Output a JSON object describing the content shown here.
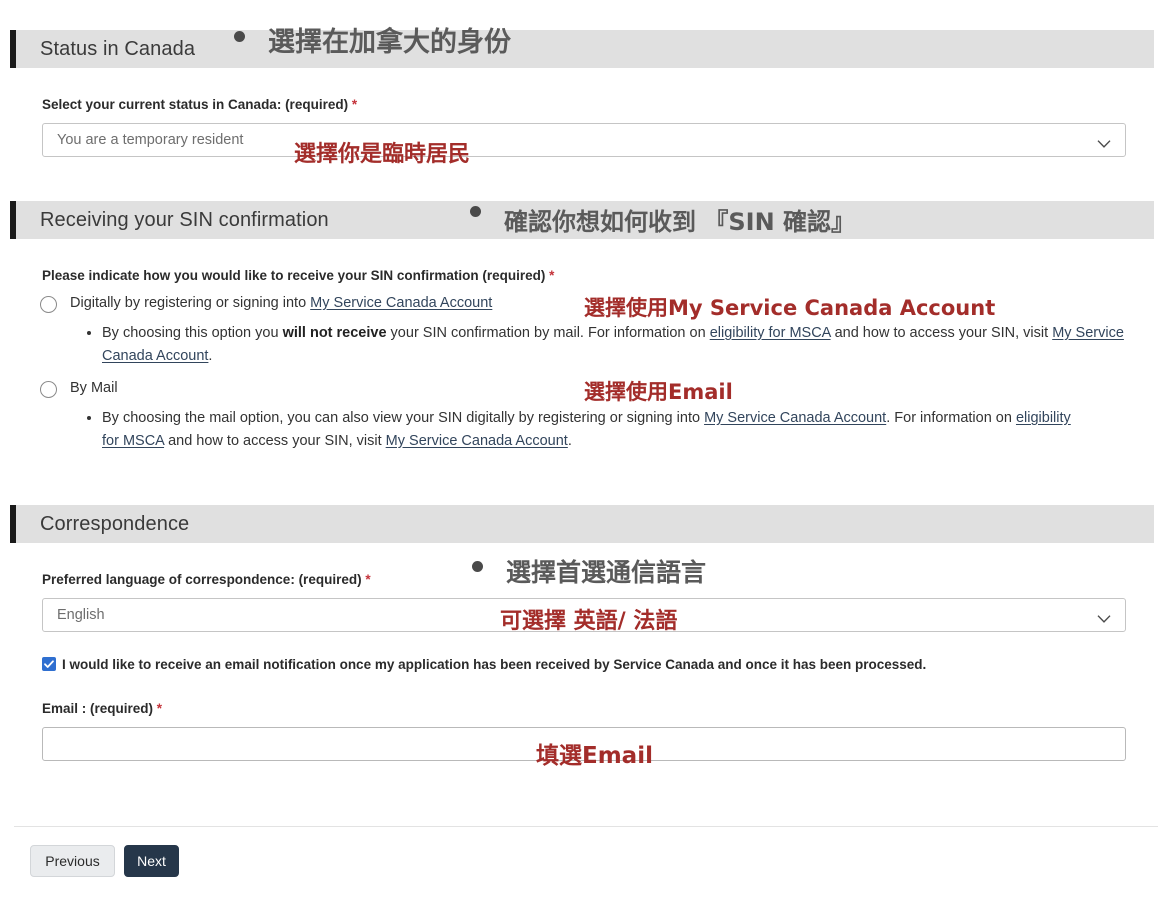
{
  "sections": {
    "status": {
      "header": "Status in Canada",
      "annotation": "選擇在加拿大的身份",
      "field_label": "Select your current status in Canada: (required)",
      "required_mark": "*",
      "select_value": "You are a temporary resident",
      "select_annotation": "選擇你是臨時居民",
      "chevron_icon": "chevron-down-icon"
    },
    "receiving": {
      "header": "Receiving your SIN confirmation",
      "annotation": "確認你想如何收到 『SIN 確認』",
      "field_label": "Please indicate how you would like to receive your SIN confirmation (required)",
      "required_mark": "*",
      "option_digital": {
        "label_pre": "Digitally by registering or signing into ",
        "label_link": "My Service Canada Account",
        "annotation": "選擇使用My Service Canada Account",
        "bullet_p1": "By choosing this option you ",
        "bullet_strong": "will not receive",
        "bullet_p2": " your SIN confirmation by mail. For information on ",
        "bullet_link1": "eligibility for MSCA",
        "bullet_p3": " and how to access your SIN, visit ",
        "bullet_link2": "My Service Canada Account",
        "bullet_p4": "."
      },
      "option_mail": {
        "label": "By Mail",
        "annotation": "選擇使用Email",
        "bullet_p1": "By choosing the mail option, you can also view your SIN digitally by registering or signing into ",
        "bullet_link1": "My Service Canada Account",
        "bullet_p2": ". For information on ",
        "bullet_link2": "eligibility for MSCA",
        "bullet_p3": " and how to access your SIN, visit ",
        "bullet_link3": "My Service Canada Account",
        "bullet_p4": "."
      }
    },
    "correspondence": {
      "header": "Correspondence",
      "annotation": "選擇首選通信語言",
      "field_label": "Preferred language of correspondence: (required)",
      "required_mark": "*",
      "select_value": "English",
      "select_annotation": "可選擇 英語/ 法語",
      "chevron_icon": "chevron-down-icon",
      "checkbox_checked": true,
      "checkbox_label": "I would like to receive an email notification once my application has been received by Service Canada and once it has been processed.",
      "email_label": "Email : (required)",
      "email_required_mark": "*",
      "email_value": "",
      "email_annotation": "填選Email"
    }
  },
  "footer": {
    "previous_label": "Previous",
    "next_label": "Next"
  },
  "colors": {
    "accent_bar": "#1a1a1a",
    "header_bg": "#e0e0e0",
    "annotation_red": "#a32d2a",
    "annotation_gray": "#5a5a5a",
    "required_red": "#c4333a",
    "link": "#32455c",
    "checkbox_blue": "#2f6fd0",
    "next_button_bg": "#26374a"
  }
}
